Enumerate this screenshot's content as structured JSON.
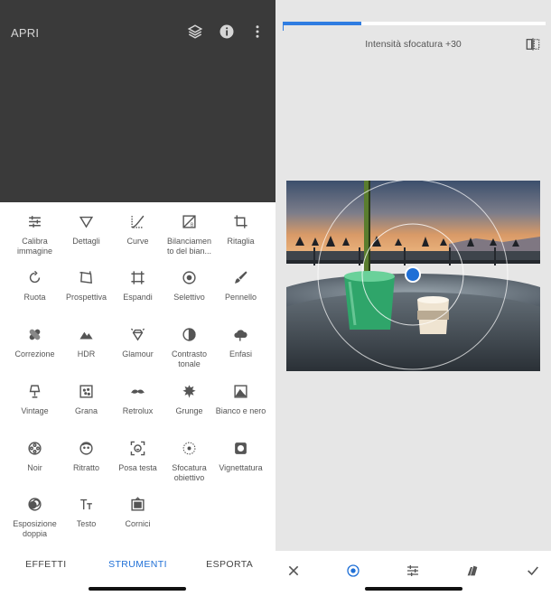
{
  "left": {
    "open_label": "APRI",
    "top_icons": [
      "layers-icon",
      "info-icon",
      "more-vertical-icon"
    ],
    "tools": [
      {
        "label": "Calibra immagine",
        "icon": "sliders-icon"
      },
      {
        "label": "Dettagli",
        "icon": "triangle-down-icon"
      },
      {
        "label": "Curve",
        "icon": "curve-icon"
      },
      {
        "label": "Bilanciamen to del bian...",
        "icon": "white-balance-icon"
      },
      {
        "label": "Ritaglia",
        "icon": "crop-icon"
      },
      {
        "label": "Ruota",
        "icon": "rotate-icon"
      },
      {
        "label": "Prospettiva",
        "icon": "perspective-icon"
      },
      {
        "label": "Espandi",
        "icon": "expand-icon"
      },
      {
        "label": "Selettivo",
        "icon": "target-icon"
      },
      {
        "label": "Pennello",
        "icon": "brush-icon"
      },
      {
        "label": "Correzione",
        "icon": "bandage-icon"
      },
      {
        "label": "HDR",
        "icon": "mountains-icon"
      },
      {
        "label": "Glamour",
        "icon": "diamond-icon"
      },
      {
        "label": "Contrasto tonale",
        "icon": "half-circle-icon"
      },
      {
        "label": "Enfasi",
        "icon": "cloud-icon"
      },
      {
        "label": "Vintage",
        "icon": "lamp-icon"
      },
      {
        "label": "Grana",
        "icon": "grain-icon"
      },
      {
        "label": "Retrolux",
        "icon": "mustache-icon"
      },
      {
        "label": "Grunge",
        "icon": "grunge-icon"
      },
      {
        "label": "Bianco e nero",
        "icon": "bw-photo-icon"
      },
      {
        "label": "Noir",
        "icon": "film-reel-icon"
      },
      {
        "label": "Ritratto",
        "icon": "face-icon"
      },
      {
        "label": "Posa testa",
        "icon": "face-frame-icon"
      },
      {
        "label": "Sfocatura obiettivo",
        "icon": "lens-blur-icon"
      },
      {
        "label": "Vignettatura",
        "icon": "vignette-icon"
      },
      {
        "label": "Esposizione doppia",
        "icon": "double-exposure-icon"
      },
      {
        "label": "Testo",
        "icon": "text-icon"
      },
      {
        "label": "Cornici",
        "icon": "frame-icon"
      }
    ],
    "tabs": [
      {
        "label": "EFFETTI",
        "active": false
      },
      {
        "label": "STRUMENTI",
        "active": true
      },
      {
        "label": "ESPORTA",
        "active": false
      }
    ]
  },
  "right": {
    "intensity_label": "Intensità sfocatura +30",
    "intensity_fraction": 0.3,
    "icons": {
      "compare": "compare-icon",
      "cancel": "close-icon",
      "focus": "focus-point-icon",
      "adjust": "sliders-icon",
      "style": "style-stack-icon",
      "apply": "checkmark-icon"
    }
  },
  "colors": {
    "accent": "#1e6fd6",
    "dark_panel": "#3a3a3a",
    "right_bg": "#e6e6e6",
    "focus_dot": "#1e6fd6"
  }
}
